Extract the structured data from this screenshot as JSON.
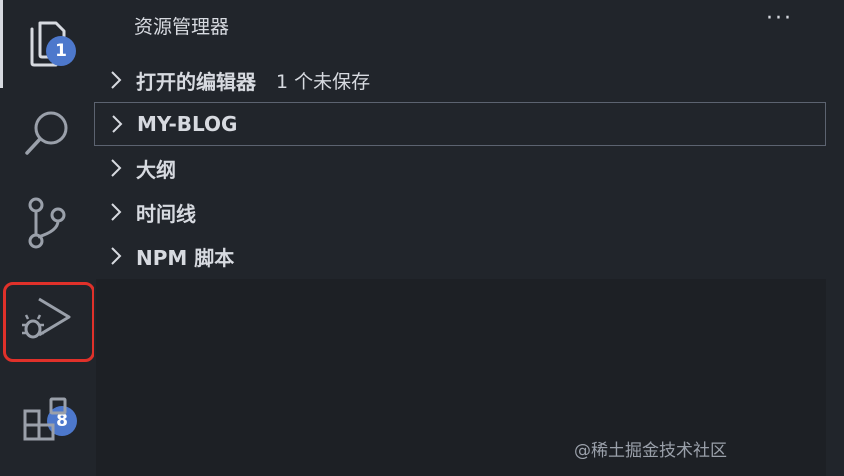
{
  "activity_bar": {
    "explorer_badge": "1",
    "scm_badge": "8",
    "icons": [
      "files-icon",
      "search-icon",
      "source-control-icon",
      "run-debug-icon",
      "extensions-icon"
    ],
    "highlight_color": "#e0312a",
    "badge_color": "#4d78cc"
  },
  "sidebar": {
    "title": "资源管理器",
    "more_label": "···",
    "sections": [
      {
        "label": "打开的编辑器",
        "extra": "1 个未保存"
      },
      {
        "label": "MY-BLOG"
      },
      {
        "label": "大纲"
      },
      {
        "label": "时间线"
      },
      {
        "label": "NPM 脚本"
      }
    ]
  },
  "watermark": "@稀土掘金技术社区",
  "colors": {
    "background": "#21252b",
    "panel": "#1d2025",
    "foreground": "#d7dae0"
  }
}
